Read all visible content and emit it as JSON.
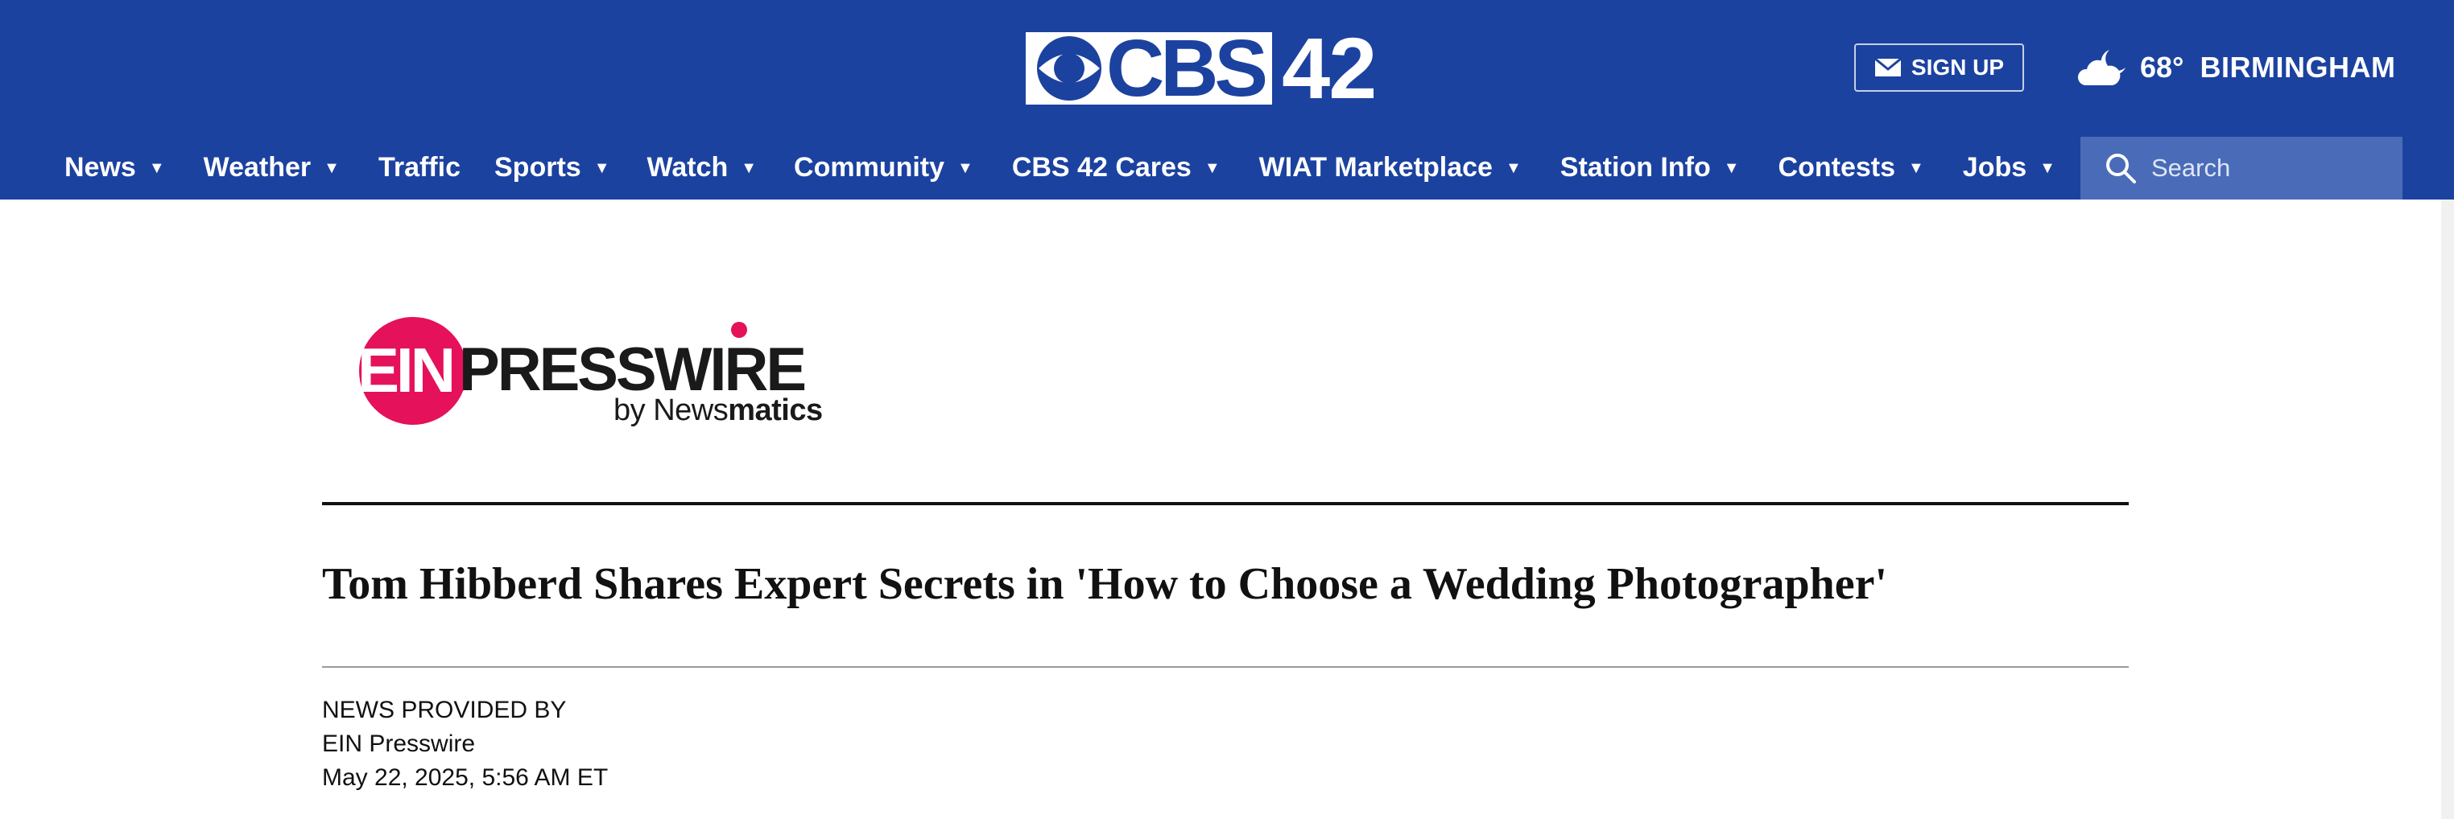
{
  "header": {
    "logo": {
      "brand": "CBS",
      "number": "42"
    },
    "signup_label": "SIGN UP",
    "weather": {
      "temperature": "68°",
      "city": "BIRMINGHAM",
      "icon": "partly-cloudy-night-icon"
    },
    "nav": [
      {
        "label": "News",
        "has_dropdown": true
      },
      {
        "label": "Weather",
        "has_dropdown": true
      },
      {
        "label": "Traffic",
        "has_dropdown": false
      },
      {
        "label": "Sports",
        "has_dropdown": true
      },
      {
        "label": "Watch",
        "has_dropdown": true
      },
      {
        "label": "Community",
        "has_dropdown": true
      },
      {
        "label": "CBS 42 Cares",
        "has_dropdown": true
      },
      {
        "label": "WIAT Marketplace",
        "has_dropdown": true
      },
      {
        "label": "Station Info",
        "has_dropdown": true
      },
      {
        "label": "Contests",
        "has_dropdown": true
      },
      {
        "label": "Jobs",
        "has_dropdown": true
      }
    ],
    "search": {
      "placeholder": "Search"
    }
  },
  "press_logo": {
    "ein": "EIN",
    "presswire": "PRESSWIRE",
    "by": "by ",
    "news": "News",
    "matics": "matics"
  },
  "article": {
    "title": "Tom Hibberd Shares Expert Secrets in 'How to Choose a Wedding Photographer'",
    "provided_by_label": "NEWS PROVIDED BY",
    "provider": "EIN Presswire",
    "date": "May 22, 2025, 5:56 AM ET"
  },
  "colors": {
    "header_bg": "#1c42a0",
    "search_bg": "#4a6cb8",
    "ein_pink": "#e5115a"
  }
}
